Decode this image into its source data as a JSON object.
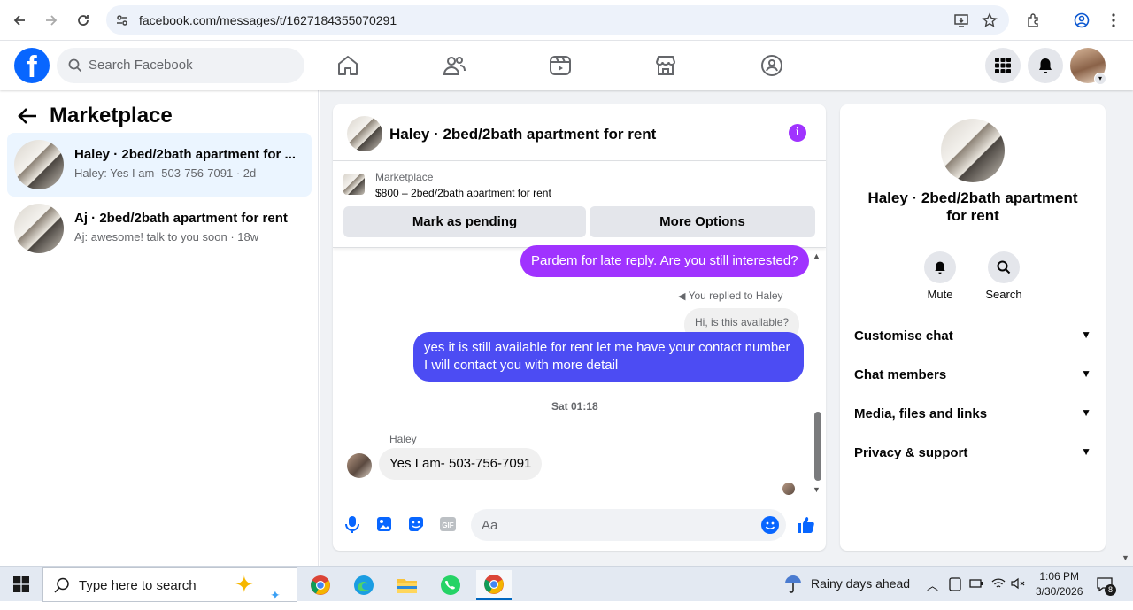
{
  "browser": {
    "url": "facebook.com/messages/t/1627184355070291"
  },
  "fbnav": {
    "search_placeholder": "Search Facebook"
  },
  "left": {
    "title": "Marketplace",
    "conversations": [
      {
        "name": "Haley · 2bed/2bath apartment for ...",
        "preview": "Haley: Yes I am- 503-756-7091 · 2d"
      },
      {
        "name": "Aj · 2bed/2bath apartment for rent",
        "preview": "Aj: awesome! talk to you soon · 18w"
      }
    ]
  },
  "chat": {
    "title": "Haley · 2bed/2bath apartment for rent",
    "marketplace_label": "Marketplace",
    "listing": "$800 – 2bed/2bath apartment for rent",
    "btn_pending": "Mark as pending",
    "btn_more": "More Options",
    "msg1": "Pardem for late reply. Are you still interested?",
    "replied": "You replied to Haley",
    "quoted": "Hi, is this available?",
    "msg2": "yes it is still available for rent let me have your contact number I will contact you with more detail",
    "timestamp": "Sat 01:18",
    "sender": "Haley",
    "msg3": "Yes I am- 503-756-7091",
    "composer_placeholder": "Aa"
  },
  "details": {
    "title": "Haley · 2bed/2bath apartment for rent",
    "mute": "Mute",
    "search": "Search",
    "rows": [
      "Customise chat",
      "Chat members",
      "Media, files and links",
      "Privacy & support"
    ]
  },
  "taskbar": {
    "search": "Type here to search",
    "weather": "Rainy days ahead",
    "time": "1:06 PM",
    "date": "3/30/2026",
    "notif_count": "8"
  },
  "colors": {
    "fb_blue": "#0866ff",
    "bubble_purple": "#a033ff",
    "bubble_blue": "#4c4cf3"
  }
}
